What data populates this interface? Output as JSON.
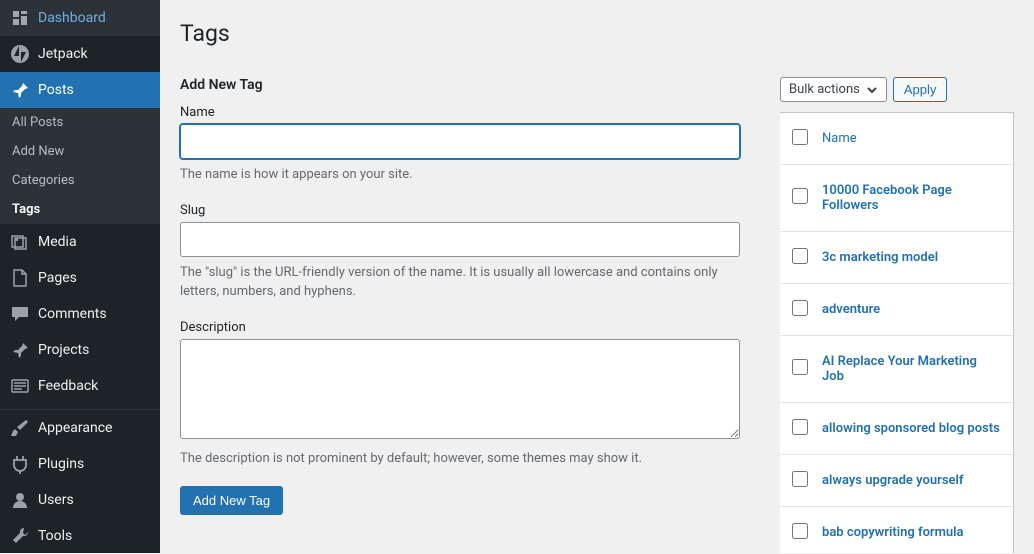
{
  "sidebar": {
    "dashboard": "Dashboard",
    "jetpack": "Jetpack",
    "posts": "Posts",
    "posts_sub": {
      "all": "All Posts",
      "add": "Add New",
      "categories": "Categories",
      "tags": "Tags"
    },
    "media": "Media",
    "pages": "Pages",
    "comments": "Comments",
    "projects": "Projects",
    "feedback": "Feedback",
    "appearance": "Appearance",
    "plugins": "Plugins",
    "users": "Users",
    "tools": "Tools"
  },
  "page": {
    "title": "Tags"
  },
  "form": {
    "heading": "Add New Tag",
    "name_label": "Name",
    "name_value": "",
    "name_help": "The name is how it appears on your site.",
    "slug_label": "Slug",
    "slug_value": "",
    "slug_help": "The \"slug\" is the URL-friendly version of the name. It is usually all lowercase and contains only letters, numbers, and hyphens.",
    "desc_label": "Description",
    "desc_value": "",
    "desc_help": "The description is not prominent by default; however, some themes may show it.",
    "submit": "Add New Tag"
  },
  "list": {
    "bulk_label": "Bulk actions",
    "apply_label": "Apply",
    "col_name": "Name",
    "rows": [
      "10000 Facebook Page Followers",
      "3c marketing model",
      "adventure",
      "AI Replace Your Marketing Job",
      "allowing sponsored blog posts",
      "always upgrade yourself",
      "bab copywriting formula"
    ]
  }
}
